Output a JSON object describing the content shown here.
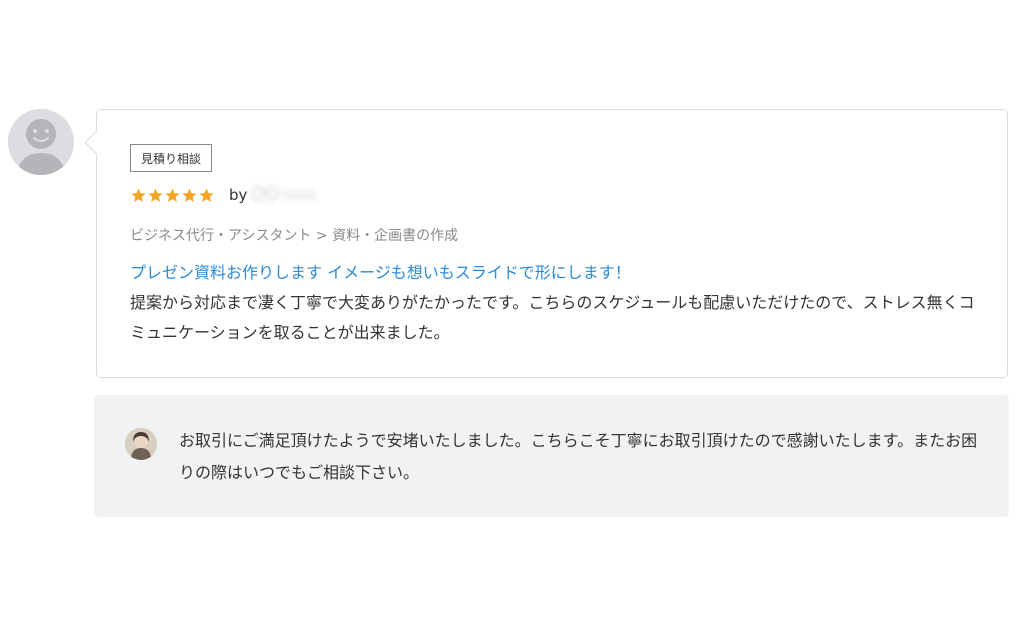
{
  "review": {
    "tag": "見積り相談",
    "rating": 5,
    "rating_max": 5,
    "star_color": "#f5a623",
    "by_label": "by",
    "reviewer_name": "〇〇 ◇◇◇",
    "category": "ビジネス代行・アシスタント > 資料・企画書の作成",
    "service_title": "プレゼン資料お作りします イメージも想いもスライドで形にします！",
    "body": "提案から対応まで凄く丁寧で大変ありがたかったです。こちらのスケジュールも配慮いただけたので、ストレス無くコミュニケーションを取ることが出来ました。",
    "avatar_icon": "default-user-icon"
  },
  "reply": {
    "text": "お取引にご満足頂けたようで安堵いたしました。こちらこそ丁寧にお取引頂けたので感謝いたします。またお困りの際はいつでもご相談下さい。",
    "avatar_icon": "seller-avatar-photo"
  },
  "colors": {
    "link": "#2b8ad6",
    "reply_background": "#f1f2f4",
    "card_border": "#dcdcdc"
  }
}
